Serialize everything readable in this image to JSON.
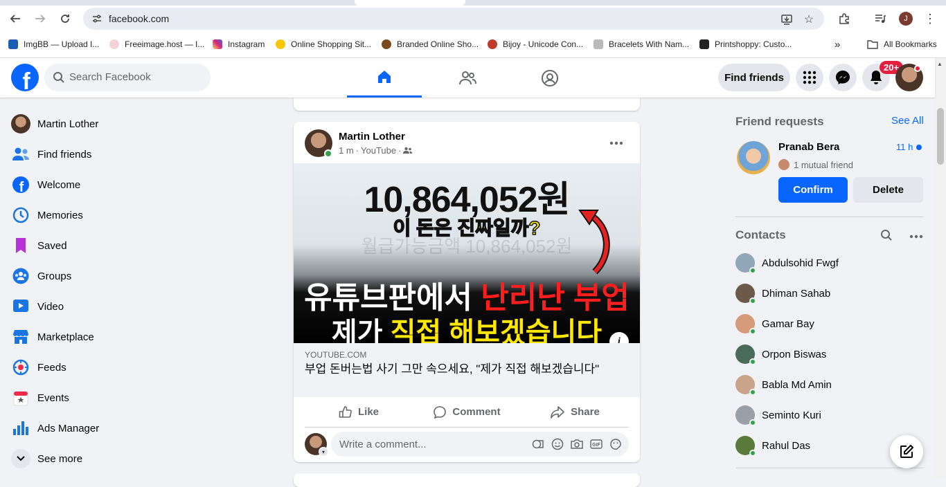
{
  "browser": {
    "url": "facebook.com",
    "profile_initial": "J",
    "bookmarks": [
      {
        "label": "ImgBB — Upload I...",
        "color": "#1a5fb4"
      },
      {
        "label": "Freeimage.host — I...",
        "color": "#e8a0a0"
      },
      {
        "label": "Instagram",
        "color": "#d6249f"
      },
      {
        "label": "Online Shopping Sit...",
        "color": "#f7c600"
      },
      {
        "label": "Branded Online Sho...",
        "color": "#7a4a1e"
      },
      {
        "label": "Bijoy - Unicode Con...",
        "color": "#c0392b"
      },
      {
        "label": "Bracelets With Nam...",
        "color": "#999999"
      },
      {
        "label": "Printshoppy: Custo...",
        "color": "#222222"
      }
    ],
    "all_bookmarks": "All Bookmarks"
  },
  "header": {
    "search_placeholder": "Search Facebook",
    "find_friends": "Find friends",
    "notif_count": "20+"
  },
  "left_nav": [
    {
      "label": "Martin Lother",
      "icon": "profile-avatar"
    },
    {
      "label": "Find friends",
      "icon": "friends-icon"
    },
    {
      "label": "Welcome",
      "icon": "facebook-icon"
    },
    {
      "label": "Memories",
      "icon": "clock-icon"
    },
    {
      "label": "Saved",
      "icon": "bookmark-icon"
    },
    {
      "label": "Groups",
      "icon": "groups-icon"
    },
    {
      "label": "Video",
      "icon": "video-icon"
    },
    {
      "label": "Marketplace",
      "icon": "shop-icon"
    },
    {
      "label": "Feeds",
      "icon": "feeds-icon"
    },
    {
      "label": "Events",
      "icon": "calendar-icon"
    },
    {
      "label": "Ads Manager",
      "icon": "bar-chart-icon"
    },
    {
      "label": "See more",
      "icon": "chevron-down-icon"
    }
  ],
  "post": {
    "author": "Martin Lother",
    "time": "1 m",
    "source": "YouTube",
    "thumbnail": {
      "amount": "10,864,052원",
      "question": "이 돈은 진짜일까?",
      "faint": "월급가능금액 10,864,052원",
      "line1_white": "유튜브판에서 ",
      "line1_red": "난리난 부업",
      "line2_white": "제가 ",
      "line2_yellow": "직접 해보겠습니다"
    },
    "link_domain": "YOUTUBE.COM",
    "link_title": "부업 돈버는법 사기 그만 속으세요, \"제가 직접 해보겠습니다\"",
    "actions": {
      "like": "Like",
      "comment": "Comment",
      "share": "Share"
    },
    "comment_placeholder": "Write a comment..."
  },
  "right": {
    "friend_requests_title": "Friend requests",
    "see_all": "See All",
    "request": {
      "name": "Pranab Bera",
      "time": "11 h",
      "mutual": "1 mutual friend",
      "confirm": "Confirm",
      "delete": "Delete"
    },
    "contacts_title": "Contacts",
    "contacts": [
      {
        "name": "Abdulsohid Fwgf",
        "color": "#8fa7b8"
      },
      {
        "name": "Dhiman Sahab",
        "color": "#6b5a4a"
      },
      {
        "name": "Gamar Bay",
        "color": "#d49a7a"
      },
      {
        "name": "Orpon Biswas",
        "color": "#4a6b5a"
      },
      {
        "name": "Babla Md Amin",
        "color": "#c9a38a"
      },
      {
        "name": "Seminto Kuri",
        "color": "#9aa0a6"
      },
      {
        "name": "Rahul Das",
        "color": "#5a7a3a"
      }
    ]
  }
}
